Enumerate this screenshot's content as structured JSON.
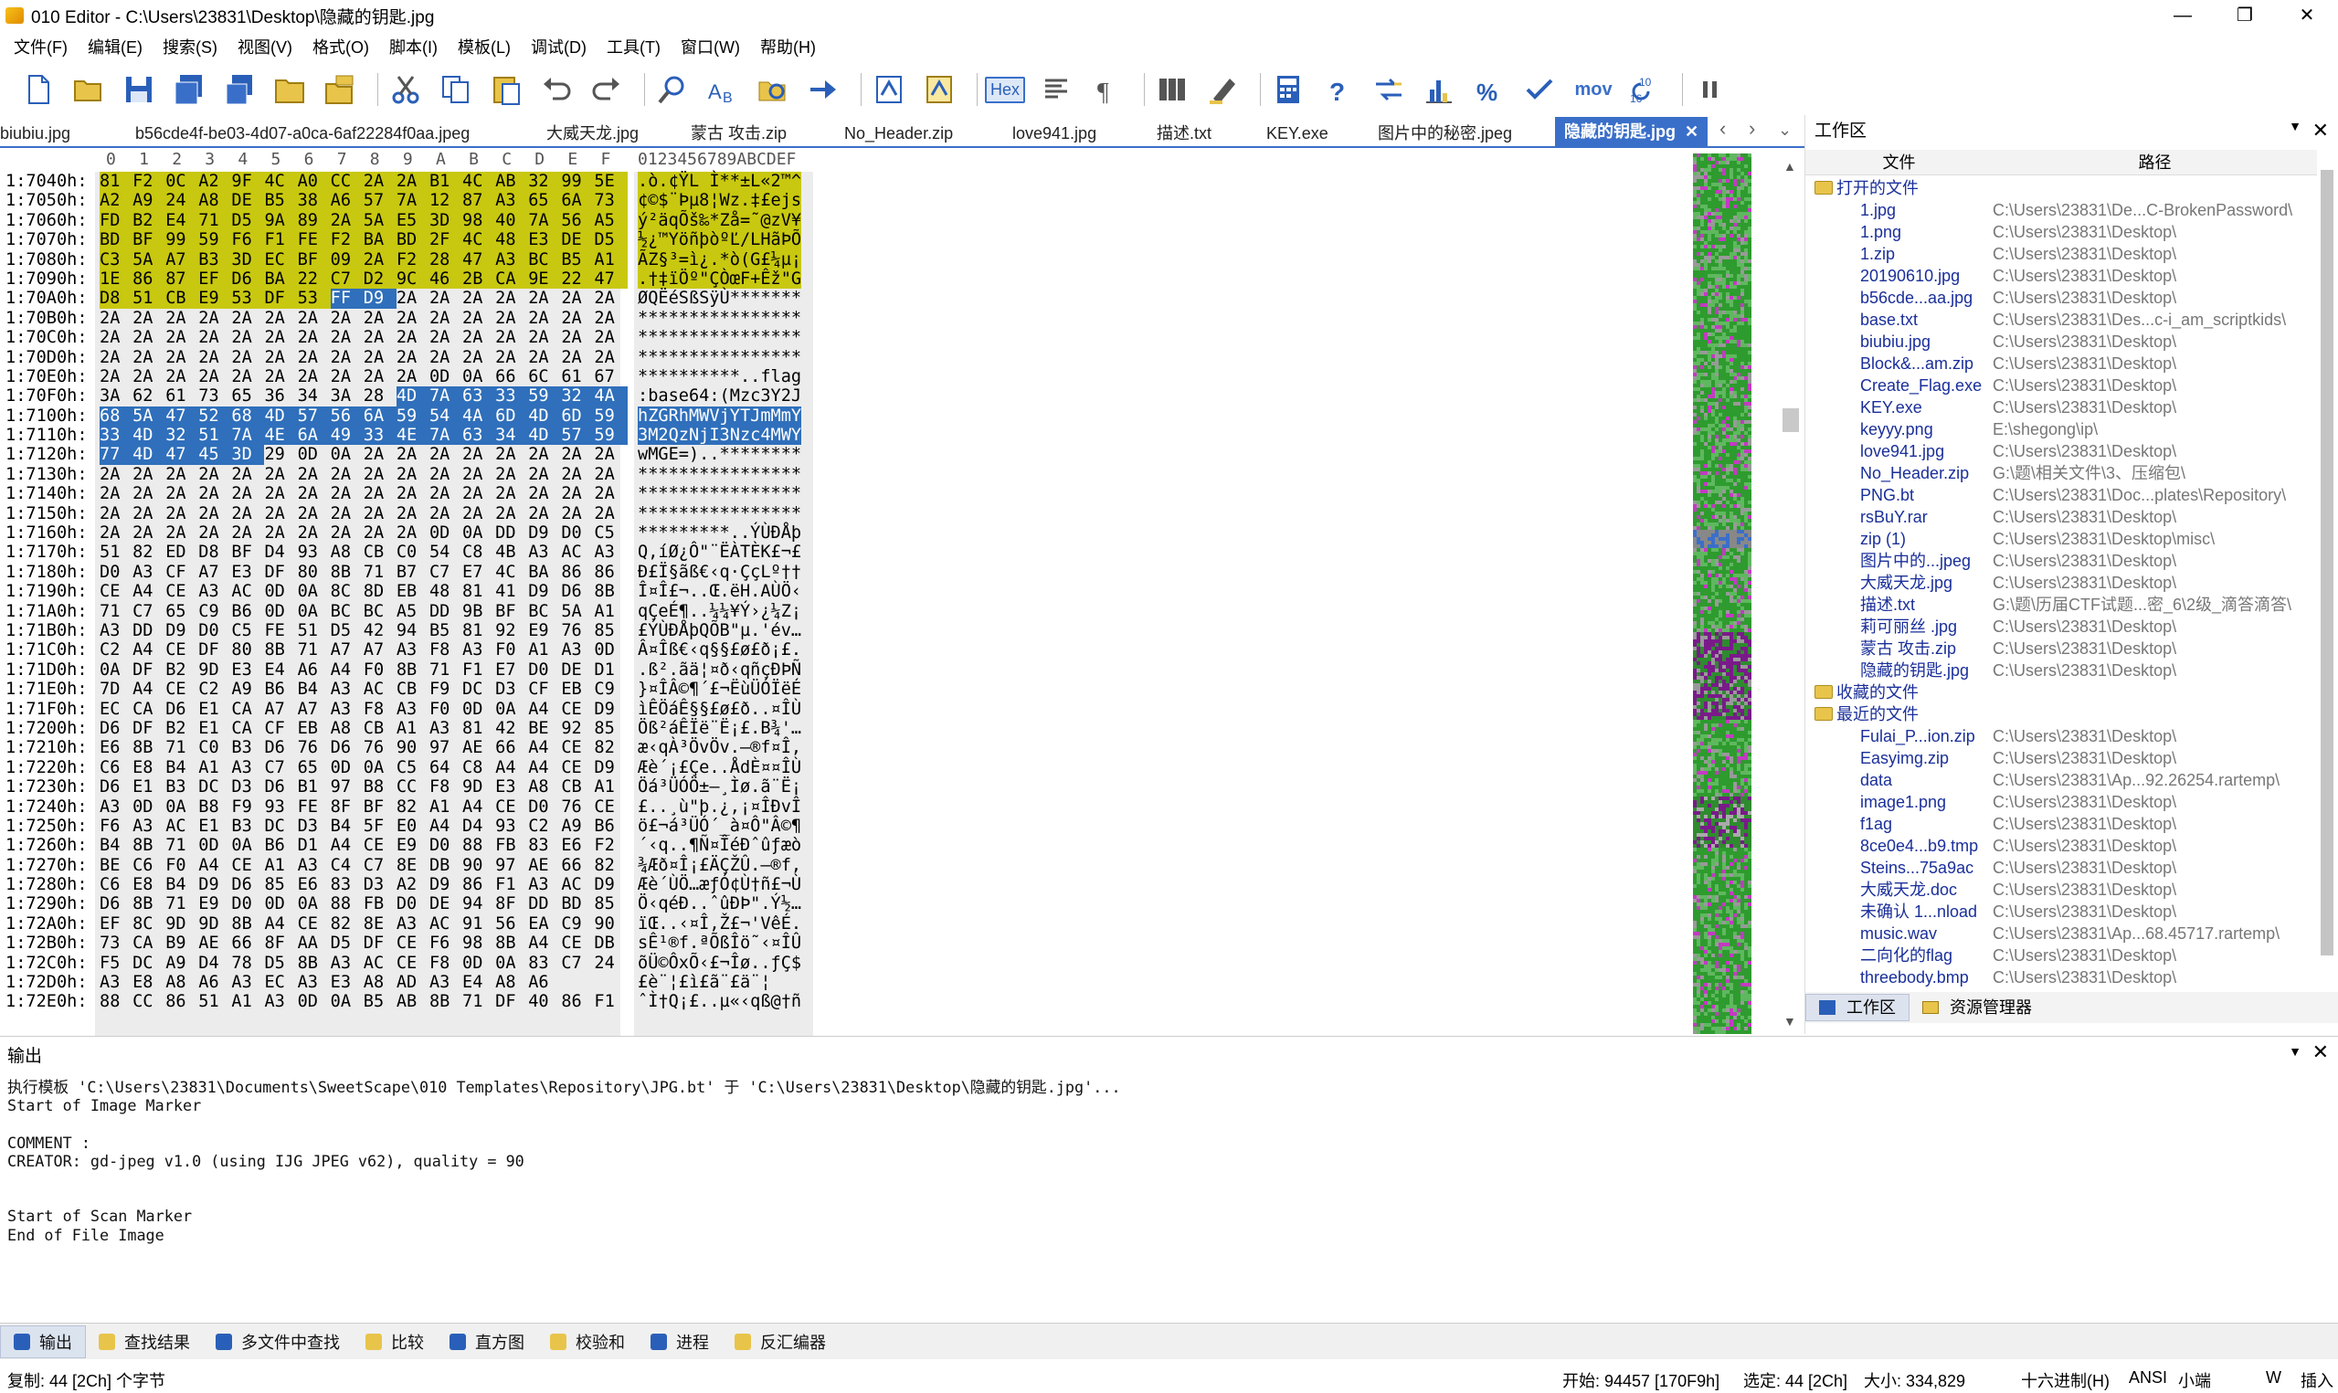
{
  "window": {
    "title": "010 Editor - C:\\Users\\23831\\Desktop\\隐藏的钥匙.jpg",
    "minimize": "—",
    "maximize": "❐",
    "close": "✕"
  },
  "menu": [
    "文件(F)",
    "编辑(E)",
    "搜索(S)",
    "视图(V)",
    "格式(O)",
    "脚本(I)",
    "模板(L)",
    "调试(D)",
    "工具(T)",
    "窗口(W)",
    "帮助(H)"
  ],
  "toolbar": {
    "hex_label": "Hex",
    "mov_label": "mov",
    "num_label": "10\n16"
  },
  "tabs": [
    "biubiu.jpg",
    "b56cde4f-be03-4d07-a0ca-6af22284f0aa.jpeg",
    "大威天龙.jpg",
    "蒙古 攻击.zip",
    "No_Header.zip",
    "love941.jpg",
    "描述.txt",
    "KEY.exe",
    "图片中的秘密.jpeg",
    "隐藏的钥匙.jpg"
  ],
  "active_tab_close": "✕",
  "hex_header": {
    "cols": [
      "0",
      "1",
      "2",
      "3",
      "4",
      "5",
      "6",
      "7",
      "8",
      "9",
      "A",
      "B",
      "C",
      "D",
      "E",
      "F"
    ],
    "ascii": "0123456789ABCDEF"
  },
  "hex_rows": [
    {
      "addr": "1:7040h:",
      "bytes": [
        "81",
        "F2",
        "0C",
        "A2",
        "9F",
        "4C",
        "A0",
        "CC",
        "2A",
        "2A",
        "B1",
        "4C",
        "AB",
        "32",
        "99",
        "5E"
      ],
      "ascii": ".ò.¢ŸL Ì**±L«2™^"
    },
    {
      "addr": "1:7050h:",
      "bytes": [
        "A2",
        "A9",
        "24",
        "A8",
        "DE",
        "B5",
        "38",
        "A6",
        "57",
        "7A",
        "12",
        "87",
        "A3",
        "65",
        "6A",
        "73"
      ],
      "ascii": "¢©$¨Þµ8¦Wz.‡£ejs"
    },
    {
      "addr": "1:7060h:",
      "bytes": [
        "FD",
        "B2",
        "E4",
        "71",
        "D5",
        "9A",
        "89",
        "2A",
        "5A",
        "E5",
        "3D",
        "98",
        "40",
        "7A",
        "56",
        "A5"
      ],
      "ascii": "ý²äqÕš‰*Zå=˜@zV¥"
    },
    {
      "addr": "1:7070h:",
      "bytes": [
        "BD",
        "BF",
        "99",
        "59",
        "F6",
        "F1",
        "FE",
        "F2",
        "BA",
        "BD",
        "2F",
        "4C",
        "48",
        "E3",
        "DE",
        "D5"
      ],
      "ascii": "½¿™YöñþòºĽ/LHãÞÕ"
    },
    {
      "addr": "1:7080h:",
      "bytes": [
        "C3",
        "5A",
        "A7",
        "B3",
        "3D",
        "EC",
        "BF",
        "09",
        "2A",
        "F2",
        "28",
        "47",
        "A3",
        "BC",
        "B5",
        "A1"
      ],
      "ascii": "ÃZ§³=ì¿.*ò(G£¼µ¡"
    },
    {
      "addr": "1:7090h:",
      "bytes": [
        "1E",
        "86",
        "87",
        "EF",
        "D6",
        "BA",
        "22",
        "C7",
        "D2",
        "9C",
        "46",
        "2B",
        "CA",
        "9E",
        "22",
        "47"
      ],
      "ascii": ".†‡ïÖº\"ÇÒœF+Êž\"G"
    },
    {
      "addr": "1:70A0h:",
      "bytes": [
        "D8",
        "51",
        "CB",
        "E9",
        "53",
        "DF",
        "53",
        "FF",
        "D9",
        "2A",
        "2A",
        "2A",
        "2A",
        "2A",
        "2A",
        "2A"
      ],
      "ascii": "ØQËéSßSÿÙ*******"
    },
    {
      "addr": "1:70B0h:",
      "bytes": [
        "2A",
        "2A",
        "2A",
        "2A",
        "2A",
        "2A",
        "2A",
        "2A",
        "2A",
        "2A",
        "2A",
        "2A",
        "2A",
        "2A",
        "2A",
        "2A"
      ],
      "ascii": "****************"
    },
    {
      "addr": "1:70C0h:",
      "bytes": [
        "2A",
        "2A",
        "2A",
        "2A",
        "2A",
        "2A",
        "2A",
        "2A",
        "2A",
        "2A",
        "2A",
        "2A",
        "2A",
        "2A",
        "2A",
        "2A"
      ],
      "ascii": "****************"
    },
    {
      "addr": "1:70D0h:",
      "bytes": [
        "2A",
        "2A",
        "2A",
        "2A",
        "2A",
        "2A",
        "2A",
        "2A",
        "2A",
        "2A",
        "2A",
        "2A",
        "2A",
        "2A",
        "2A",
        "2A"
      ],
      "ascii": "****************"
    },
    {
      "addr": "1:70E0h:",
      "bytes": [
        "2A",
        "2A",
        "2A",
        "2A",
        "2A",
        "2A",
        "2A",
        "2A",
        "2A",
        "2A",
        "0D",
        "0A",
        "66",
        "6C",
        "61",
        "67"
      ],
      "ascii": "**********..flag"
    },
    {
      "addr": "1:70F0h:",
      "bytes": [
        "3A",
        "62",
        "61",
        "73",
        "65",
        "36",
        "34",
        "3A",
        "28",
        "4D",
        "7A",
        "63",
        "33",
        "59",
        "32",
        "4A"
      ],
      "ascii": ":base64:(Mzc3Y2J"
    },
    {
      "addr": "1:7100h:",
      "bytes": [
        "68",
        "5A",
        "47",
        "52",
        "68",
        "4D",
        "57",
        "56",
        "6A",
        "59",
        "54",
        "4A",
        "6D",
        "4D",
        "6D",
        "59"
      ],
      "ascii": "hZGRhMWVjYTJmMmY"
    },
    {
      "addr": "1:7110h:",
      "bytes": [
        "33",
        "4D",
        "32",
        "51",
        "7A",
        "4E",
        "6A",
        "49",
        "33",
        "4E",
        "7A",
        "63",
        "34",
        "4D",
        "57",
        "59"
      ],
      "ascii": "3M2QzNjI3Nzc4MWY"
    },
    {
      "addr": "1:7120h:",
      "bytes": [
        "77",
        "4D",
        "47",
        "45",
        "3D",
        "29",
        "0D",
        "0A",
        "2A",
        "2A",
        "2A",
        "2A",
        "2A",
        "2A",
        "2A",
        "2A"
      ],
      "ascii": "wMGE=)..********"
    },
    {
      "addr": "1:7130h:",
      "bytes": [
        "2A",
        "2A",
        "2A",
        "2A",
        "2A",
        "2A",
        "2A",
        "2A",
        "2A",
        "2A",
        "2A",
        "2A",
        "2A",
        "2A",
        "2A",
        "2A"
      ],
      "ascii": "****************"
    },
    {
      "addr": "1:7140h:",
      "bytes": [
        "2A",
        "2A",
        "2A",
        "2A",
        "2A",
        "2A",
        "2A",
        "2A",
        "2A",
        "2A",
        "2A",
        "2A",
        "2A",
        "2A",
        "2A",
        "2A"
      ],
      "ascii": "****************"
    },
    {
      "addr": "1:7150h:",
      "bytes": [
        "2A",
        "2A",
        "2A",
        "2A",
        "2A",
        "2A",
        "2A",
        "2A",
        "2A",
        "2A",
        "2A",
        "2A",
        "2A",
        "2A",
        "2A",
        "2A"
      ],
      "ascii": "****************"
    },
    {
      "addr": "1:7160h:",
      "bytes": [
        "2A",
        "2A",
        "2A",
        "2A",
        "2A",
        "2A",
        "2A",
        "2A",
        "2A",
        "2A",
        "0D",
        "0A",
        "DD",
        "D9",
        "D0",
        "C5",
        "FE"
      ],
      "ascii": "*********..ÝÙÐÅþ"
    },
    {
      "addr": "1:7170h:",
      "bytes": [
        "51",
        "82",
        "ED",
        "D8",
        "BF",
        "D4",
        "93",
        "A8",
        "CB",
        "C0",
        "54",
        "C8",
        "4B",
        "A3",
        "AC",
        "A3"
      ],
      "ascii": "Q‚íØ¿Ô\"¨ËÀTÈK£¬£"
    },
    {
      "addr": "1:7180h:",
      "bytes": [
        "D0",
        "A3",
        "CF",
        "A7",
        "E3",
        "DF",
        "80",
        "8B",
        "71",
        "B7",
        "C7",
        "E7",
        "4C",
        "BA",
        "86",
        "86"
      ],
      "ascii": "Ð£Ï§ãß€‹q·ÇçLº††"
    },
    {
      "addr": "1:7190h:",
      "bytes": [
        "CE",
        "A4",
        "CE",
        "A3",
        "AC",
        "0D",
        "0A",
        "8C",
        "8D",
        "EB",
        "48",
        "81",
        "41",
        "D9",
        "D6",
        "8B"
      ],
      "ascii": "Î¤Î£¬..Œ.ëH.AÙÖ‹"
    },
    {
      "addr": "1:71A0h:",
      "bytes": [
        "71",
        "C7",
        "65",
        "C9",
        "B6",
        "0D",
        "0A",
        "BC",
        "BC",
        "A5",
        "DD",
        "9B",
        "BF",
        "BC",
        "5A",
        "A1"
      ],
      "ascii": "qÇeÉ¶..¼¼¥Ý›¿¼Z¡"
    },
    {
      "addr": "1:71B0h:",
      "bytes": [
        "A3",
        "DD",
        "D9",
        "D0",
        "C5",
        "FE",
        "51",
        "D5",
        "42",
        "94",
        "B5",
        "81",
        "92",
        "E9",
        "76",
        "85"
      ],
      "ascii": "£ÝÙÐÅþQÕB\"µ.'év…"
    },
    {
      "addr": "1:71C0h:",
      "bytes": [
        "C2",
        "A4",
        "CE",
        "DF",
        "80",
        "8B",
        "71",
        "A7",
        "A7",
        "A3",
        "F8",
        "A3",
        "F0",
        "A1",
        "A3",
        "0D"
      ],
      "ascii": "Â¤Îß€‹q§§£ø£ð¡£."
    },
    {
      "addr": "1:71D0h:",
      "bytes": [
        "0A",
        "DF",
        "B2",
        "9D",
        "E3",
        "E4",
        "A6",
        "A4",
        "F0",
        "8B",
        "71",
        "F1",
        "E7",
        "D0",
        "DE",
        "D1"
      ],
      "ascii": ".ß².ãä¦¤ð‹qñçÐÞÑ"
    },
    {
      "addr": "1:71E0h:",
      "bytes": [
        "7D",
        "A4",
        "CE",
        "C2",
        "A9",
        "B6",
        "B4",
        "A3",
        "AC",
        "CB",
        "F9",
        "DC",
        "D3",
        "CF",
        "EB",
        "C9"
      ],
      "ascii": "}¤ÎÂ©¶´£¬ËùÜÓÏëÉ"
    },
    {
      "addr": "1:71F0h:",
      "bytes": [
        "EC",
        "CA",
        "D6",
        "E1",
        "CA",
        "A7",
        "A7",
        "A3",
        "F8",
        "A3",
        "F0",
        "0D",
        "0A",
        "A4",
        "CE",
        "D9"
      ],
      "ascii": "ìÊÖáÊ§§£ø£ð..¤ÎÙ"
    },
    {
      "addr": "1:7200h:",
      "bytes": [
        "D6",
        "DF",
        "B2",
        "E1",
        "CA",
        "CF",
        "EB",
        "A8",
        "CB",
        "A1",
        "A3",
        "81",
        "42",
        "BE",
        "92",
        "85"
      ],
      "ascii": "Öß²áÊÏë¨Ë¡£.B¾'…"
    },
    {
      "addr": "1:7210h:",
      "bytes": [
        "E6",
        "8B",
        "71",
        "C0",
        "B3",
        "D6",
        "76",
        "D6",
        "76",
        "90",
        "97",
        "AE",
        "66",
        "A4",
        "CE",
        "82"
      ],
      "ascii": "æ‹qÀ³ÖvÖv.—®f¤Î‚"
    },
    {
      "addr": "1:7220h:",
      "bytes": [
        "C6",
        "E8",
        "B4",
        "A1",
        "A3",
        "C7",
        "65",
        "0D",
        "0A",
        "C5",
        "64",
        "C8",
        "A4",
        "A4",
        "CE",
        "D9"
      ],
      "ascii": "Æè´¡£Çe..ÅdÈ¤¤ÎÙ"
    },
    {
      "addr": "1:7230h:",
      "bytes": [
        "D6",
        "E1",
        "B3",
        "DC",
        "D3",
        "D6",
        "B1",
        "97",
        "B8",
        "CC",
        "F8",
        "9D",
        "E3",
        "A8",
        "CB",
        "A1"
      ],
      "ascii": "Öá³ÜÓÖ±—¸Ìø.ã¨Ë¡"
    },
    {
      "addr": "1:7240h:",
      "bytes": [
        "A3",
        "0D",
        "0A",
        "B8",
        "F9",
        "93",
        "FE",
        "8F",
        "BF",
        "82",
        "A1",
        "A4",
        "CE",
        "D0",
        "76",
        "CE"
      ],
      "ascii": "£..¸ù\"þ.¿‚¡¤ÎÐvÎ"
    },
    {
      "addr": "1:7250h:",
      "bytes": [
        "F6",
        "A3",
        "AC",
        "E1",
        "B3",
        "DC",
        "D3",
        "B4",
        "5F",
        "E0",
        "A4",
        "D4",
        "93",
        "C2",
        "A9",
        "B6"
      ],
      "ascii": "ö£¬á³ÜÓ´_à¤Ô\"Â©¶"
    },
    {
      "addr": "1:7260h:",
      "bytes": [
        "B4",
        "8B",
        "71",
        "0D",
        "0A",
        "B6",
        "D1",
        "A4",
        "CE",
        "E9",
        "D0",
        "88",
        "FB",
        "83",
        "E6",
        "F2"
      ],
      "ascii": "´‹q..¶Ñ¤ÎéÐˆûƒæò"
    },
    {
      "addr": "1:7270h:",
      "bytes": [
        "BE",
        "C6",
        "F0",
        "A4",
        "CE",
        "A1",
        "A3",
        "C4",
        "C7",
        "8E",
        "DB",
        "90",
        "97",
        "AE",
        "66",
        "82"
      ],
      "ascii": "¾Æð¤Î¡£ÄÇŽÛ.—®f‚"
    },
    {
      "addr": "1:7280h:",
      "bytes": [
        "C6",
        "E8",
        "B4",
        "D9",
        "D6",
        "85",
        "E6",
        "83",
        "D3",
        "A2",
        "D9",
        "86",
        "F1",
        "A3",
        "AC",
        "D9"
      ],
      "ascii": "Æè´ÙÖ…æƒÓ¢Ù†ñ£¬Ù"
    },
    {
      "addr": "1:7290h:",
      "bytes": [
        "D6",
        "8B",
        "71",
        "E9",
        "D0",
        "0D",
        "0A",
        "88",
        "FB",
        "D0",
        "DE",
        "94",
        "8F",
        "DD",
        "BD",
        "85"
      ],
      "ascii": "Ö‹qéÐ..ˆûÐÞ\".Ý½…"
    },
    {
      "addr": "1:72A0h:",
      "bytes": [
        "EF",
        "8C",
        "9D",
        "9D",
        "8B",
        "A4",
        "CE",
        "82",
        "8E",
        "A3",
        "AC",
        "91",
        "56",
        "EA",
        "C9",
        "90"
      ],
      "ascii": "ïŒ..‹¤Î‚Ž£¬'VêÉ."
    },
    {
      "addr": "1:72B0h:",
      "bytes": [
        "73",
        "CA",
        "B9",
        "AE",
        "66",
        "8F",
        "AA",
        "D5",
        "DF",
        "CE",
        "F6",
        "98",
        "8B",
        "A4",
        "CE",
        "DB"
      ],
      "ascii": "sÊ¹®f.ªÕßÎö˜‹¤ÎÛ"
    },
    {
      "addr": "1:72C0h:",
      "bytes": [
        "F5",
        "DC",
        "A9",
        "D4",
        "78",
        "D5",
        "8B",
        "A3",
        "AC",
        "CE",
        "F8",
        "0D",
        "0A",
        "83",
        "C7",
        "24"
      ],
      "ascii": "õÜ©ÔxÕ‹£¬Îø..ƒÇ$"
    },
    {
      "addr": "1:72D0h:",
      "bytes": [
        "A3",
        "E8",
        "A8",
        "A6",
        "A3",
        "EC",
        "A3",
        "E3",
        "A8",
        "AD",
        "A3",
        "E4",
        "A8",
        "A6"
      ],
      "ascii": "£è¨¦£ì£ã¨­£ä¨¦"
    },
    {
      "addr": "1:72E0h:",
      "bytes": [
        "88",
        "CC",
        "86",
        "51",
        "A1",
        "A3",
        "0D",
        "0A",
        "B5",
        "AB",
        "8B",
        "71",
        "DF",
        "40",
        "86",
        "F1"
      ],
      "ascii": "ˆÌ†Q¡£..µ«‹qß@†ñ"
    }
  ],
  "workspace": {
    "title": "工作区",
    "col_file": "文件",
    "col_path": "路径",
    "open_group": "打开的文件",
    "open_files": [
      {
        "name": "1.jpg",
        "path": "C:\\Users\\23831\\De...C-BrokenPassword\\"
      },
      {
        "name": "1.png",
        "path": "C:\\Users\\23831\\Desktop\\"
      },
      {
        "name": "1.zip",
        "path": "C:\\Users\\23831\\Desktop\\"
      },
      {
        "name": "20190610.jpg",
        "path": "C:\\Users\\23831\\Desktop\\"
      },
      {
        "name": "b56cde...aa.jpg",
        "path": "C:\\Users\\23831\\Desktop\\"
      },
      {
        "name": "base.txt",
        "path": "C:\\Users\\23831\\Des...c-i_am_scriptkids\\"
      },
      {
        "name": "biubiu.jpg",
        "path": "C:\\Users\\23831\\Desktop\\"
      },
      {
        "name": "Block&...am.zip",
        "path": "C:\\Users\\23831\\Desktop\\"
      },
      {
        "name": "Create_Flag.exe",
        "path": "C:\\Users\\23831\\Desktop\\"
      },
      {
        "name": "KEY.exe",
        "path": "C:\\Users\\23831\\Desktop\\"
      },
      {
        "name": "keyyy.png",
        "path": "E:\\shegong\\ip\\"
      },
      {
        "name": "love941.jpg",
        "path": "C:\\Users\\23831\\Desktop\\"
      },
      {
        "name": "No_Header.zip",
        "path": "G:\\题\\相关文件\\3、压缩包\\"
      },
      {
        "name": "PNG.bt",
        "path": "C:\\Users\\23831\\Doc...plates\\Repository\\"
      },
      {
        "name": "rsBuY.rar",
        "path": "C:\\Users\\23831\\Desktop\\"
      },
      {
        "name": "zip (1)",
        "path": "C:\\Users\\23831\\Desktop\\misc\\"
      },
      {
        "name": "图片中的...jpeg",
        "path": "C:\\Users\\23831\\Desktop\\"
      },
      {
        "name": "大威天龙.jpg",
        "path": "C:\\Users\\23831\\Desktop\\"
      },
      {
        "name": "描述.txt",
        "path": "G:\\题\\历届CTF试题...密_6\\2级_滴答滴答\\"
      },
      {
        "name": "莉可丽丝 .jpg",
        "path": "C:\\Users\\23831\\Desktop\\"
      },
      {
        "name": "蒙古 攻击.zip",
        "path": "C:\\Users\\23831\\Desktop\\"
      },
      {
        "name": "隐藏的钥匙.jpg",
        "path": "C:\\Users\\23831\\Desktop\\"
      }
    ],
    "fav_group": "收藏的文件",
    "recent_group": "最近的文件",
    "recent_files": [
      {
        "name": "Fulai_P...ion.zip",
        "path": "C:\\Users\\23831\\Desktop\\"
      },
      {
        "name": "Easyimg.zip",
        "path": "C:\\Users\\23831\\Desktop\\"
      },
      {
        "name": "data",
        "path": "C:\\Users\\23831\\Ap...92.26254.rartemp\\"
      },
      {
        "name": "image1.png",
        "path": "C:\\Users\\23831\\Desktop\\"
      },
      {
        "name": "f1ag",
        "path": "C:\\Users\\23831\\Desktop\\"
      },
      {
        "name": "8ce0e4...b9.tmp",
        "path": "C:\\Users\\23831\\Desktop\\"
      },
      {
        "name": "Steins...75a9ac",
        "path": "C:\\Users\\23831\\Desktop\\"
      },
      {
        "name": "大威天龙.doc",
        "path": "C:\\Users\\23831\\Desktop\\"
      },
      {
        "name": "未确认 1...nload",
        "path": "C:\\Users\\23831\\Desktop\\"
      },
      {
        "name": "music.wav",
        "path": "C:\\Users\\23831\\Ap...68.45717.rartemp\\"
      },
      {
        "name": "二向化的flag",
        "path": "C:\\Users\\23831\\Desktop\\"
      },
      {
        "name": "threebody.bmp",
        "path": "C:\\Users\\23831\\Desktop\\"
      }
    ],
    "tab_workspace": "工作区",
    "tab_explorer": "资源管理器"
  },
  "output": {
    "title": "输出",
    "lines": "执行模板 'C:\\Users\\23831\\Documents\\SweetScape\\010 Templates\\Repository\\JPG.bt' 于 'C:\\Users\\23831\\Desktop\\隐藏的钥匙.jpg'...\nStart of Image Marker\n\nCOMMENT :\nCREATOR: gd-jpeg v1.0 (using IJG JPEG v62), quality = 90\n\n\nStart of Scan Marker\nEnd of File Image"
  },
  "bottom_tabs": [
    "输出",
    "查找结果",
    "多文件中查找",
    "比较",
    "直方图",
    "校验和",
    "进程",
    "反汇编器"
  ],
  "status": {
    "left": "复制: 44 [2Ch] 个字节",
    "start": "开始: 94457 [170F9h]",
    "sel": "选定: 44 [2Ch]",
    "size": "大小: 334,829",
    "mode": "十六进制(H)",
    "enc": "ANSI",
    "endian": "小端",
    "w": "W",
    "ins": "插入"
  }
}
